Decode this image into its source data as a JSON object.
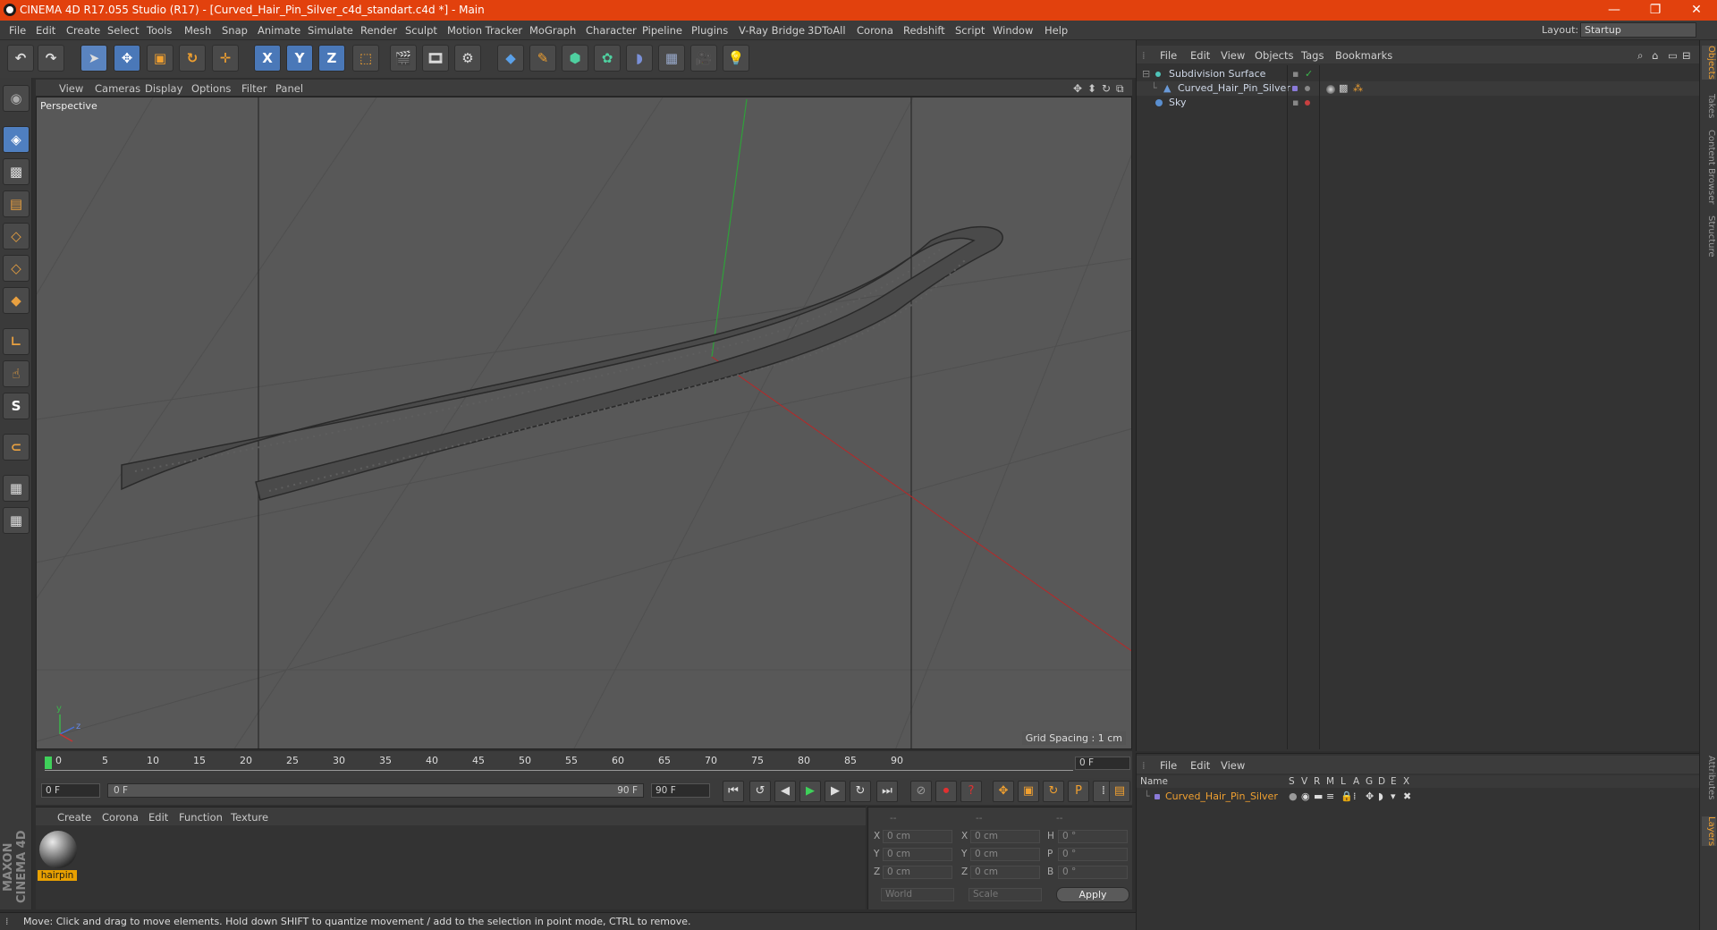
{
  "title_bar": {
    "title": "CINEMA 4D R17.055 Studio (R17) - [Curved_Hair_Pin_Silver_c4d_standart.c4d *] - Main",
    "minimize": "—",
    "maximize": "❐",
    "close": "✕"
  },
  "menubar": {
    "items": [
      "File",
      "Edit",
      "Create",
      "Select",
      "Tools",
      "Mesh",
      "Snap",
      "Animate",
      "Simulate",
      "Render",
      "Sculpt",
      "Motion Tracker",
      "MoGraph",
      "Character",
      "Pipeline",
      "Plugins",
      "V-Ray Bridge",
      "3DToAll",
      "Corona",
      "Redshift",
      "Script",
      "Window",
      "Help"
    ],
    "layout_label": "Layout:",
    "layout_value": "Startup"
  },
  "toolbar": {
    "axis_x": "X",
    "axis_y": "Y",
    "axis_z": "Z"
  },
  "viewport": {
    "menu": [
      "View",
      "Cameras",
      "Display",
      "Options",
      "Filter",
      "Panel"
    ],
    "label": "Perspective",
    "grid_spacing": "Grid Spacing : 1 cm",
    "axis_y": "y",
    "axis_z": "z"
  },
  "timeline": {
    "ticks": [
      "0",
      "5",
      "10",
      "15",
      "20",
      "25",
      "30",
      "35",
      "40",
      "45",
      "50",
      "55",
      "60",
      "65",
      "70",
      "75",
      "80",
      "85",
      "90"
    ],
    "current_frame": "0 F",
    "start_frame": "0 F",
    "slider_start": "0 F",
    "slider_end": "90 F",
    "end_frame": "90 F"
  },
  "material_manager": {
    "menu": [
      "Create",
      "Corona",
      "Edit",
      "Function",
      "Texture"
    ],
    "materials": [
      {
        "name": "hairpin"
      }
    ]
  },
  "coordinates": {
    "header": [
      "--",
      "--",
      "--"
    ],
    "rows": [
      {
        "a_label": "X",
        "a_value": "0 cm",
        "b_label": "X",
        "b_value": "0 cm",
        "c_label": "H",
        "c_value": "0 °"
      },
      {
        "a_label": "Y",
        "a_value": "0 cm",
        "b_label": "Y",
        "b_value": "0 cm",
        "c_label": "P",
        "c_value": "0 °"
      },
      {
        "a_label": "Z",
        "a_value": "0 cm",
        "b_label": "Z",
        "b_value": "0 cm",
        "c_label": "B",
        "c_value": "0 °"
      }
    ],
    "mode_world": "World",
    "mode_scale": "Scale",
    "apply": "Apply"
  },
  "object_manager": {
    "menu": [
      "File",
      "Edit",
      "View",
      "Objects",
      "Tags",
      "Bookmarks"
    ],
    "objects": [
      {
        "name": "Subdivision Surface",
        "color": "#4fc3b8"
      },
      {
        "name": "Curved_Hair_Pin_Silver",
        "color": "#6a9ad8"
      },
      {
        "name": "Sky",
        "color": "#5a8fd0"
      }
    ]
  },
  "layer_manager": {
    "menu": [
      "File",
      "Edit",
      "View"
    ],
    "columns": [
      "Name",
      "S",
      "V",
      "R",
      "M",
      "L",
      "A",
      "G",
      "D",
      "E",
      "X"
    ],
    "layers": [
      {
        "name": "Curved_Hair_Pin_Silver",
        "color": "#8a7ad8"
      }
    ]
  },
  "right_tabs": [
    "Objects",
    "Takes",
    "Content Browser",
    "Structure",
    "Attributes",
    "Layers"
  ],
  "status": {
    "text": "Move: Click and drag to move elements. Hold down SHIFT to quantize movement / add to the selection in point mode, CTRL to remove."
  },
  "branding": {
    "logo": "MAXON CINEMA 4D"
  },
  "colors": {
    "title_bar": "#e2410d",
    "accent_blue": "#4a78b8",
    "accent_orange": "#e8a000",
    "y_axis": "#3cb44b",
    "x_axis": "#c83232"
  }
}
